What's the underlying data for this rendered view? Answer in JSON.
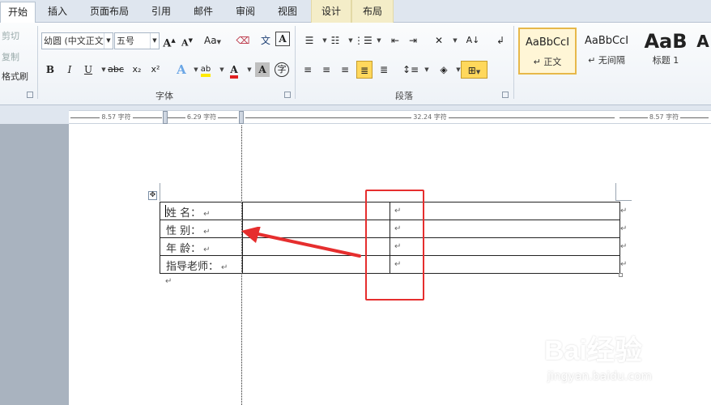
{
  "tabs": [
    {
      "label": "开始"
    },
    {
      "label": "插入"
    },
    {
      "label": "页面布局"
    },
    {
      "label": "引用"
    },
    {
      "label": "邮件"
    },
    {
      "label": "审阅"
    },
    {
      "label": "视图"
    },
    {
      "label": "设计"
    },
    {
      "label": "布局"
    }
  ],
  "clipboard": {
    "cut": "剪切",
    "copy": "复制",
    "format_painter": "格式刷"
  },
  "font": {
    "name": "幼圆 (中文正文",
    "size": "五号",
    "group_label": "字体",
    "change_case": "Aa",
    "bold": "B",
    "italic": "I",
    "underline": "U",
    "strike": "abc",
    "sub": "x₂",
    "sup": "x²"
  },
  "paragraph": {
    "group_label": "段落"
  },
  "styles": [
    {
      "sample": "AaBbCcI",
      "name": "↵ 正文"
    },
    {
      "sample": "AaBbCcI",
      "name": "↵ 无间隔"
    },
    {
      "sample": "AaB",
      "name": "标题 1"
    },
    {
      "sample": "A",
      "name": ""
    }
  ],
  "ruler": {
    "segments": [
      "8.57 字符",
      "6.29 字符",
      "32.24 字符",
      "8.57 字符"
    ]
  },
  "table": {
    "rows": [
      {
        "label": "姓    名：",
        "mark": "↵",
        "value_mark": "↵",
        "end": "↵"
      },
      {
        "label": "性    别：",
        "mark": "↵",
        "value_mark": "↵",
        "end": "↵"
      },
      {
        "label": "年    龄：",
        "mark": "↵",
        "value_mark": "↵",
        "end": "↵"
      },
      {
        "label": "指导老师：",
        "mark": "↵",
        "value_mark": "↵",
        "end": "↵"
      }
    ],
    "after_mark": "↵"
  },
  "annotation_color": "#e62e2e",
  "watermark": {
    "text": "Bai经验",
    "url": "jingyan.baidu.com"
  }
}
